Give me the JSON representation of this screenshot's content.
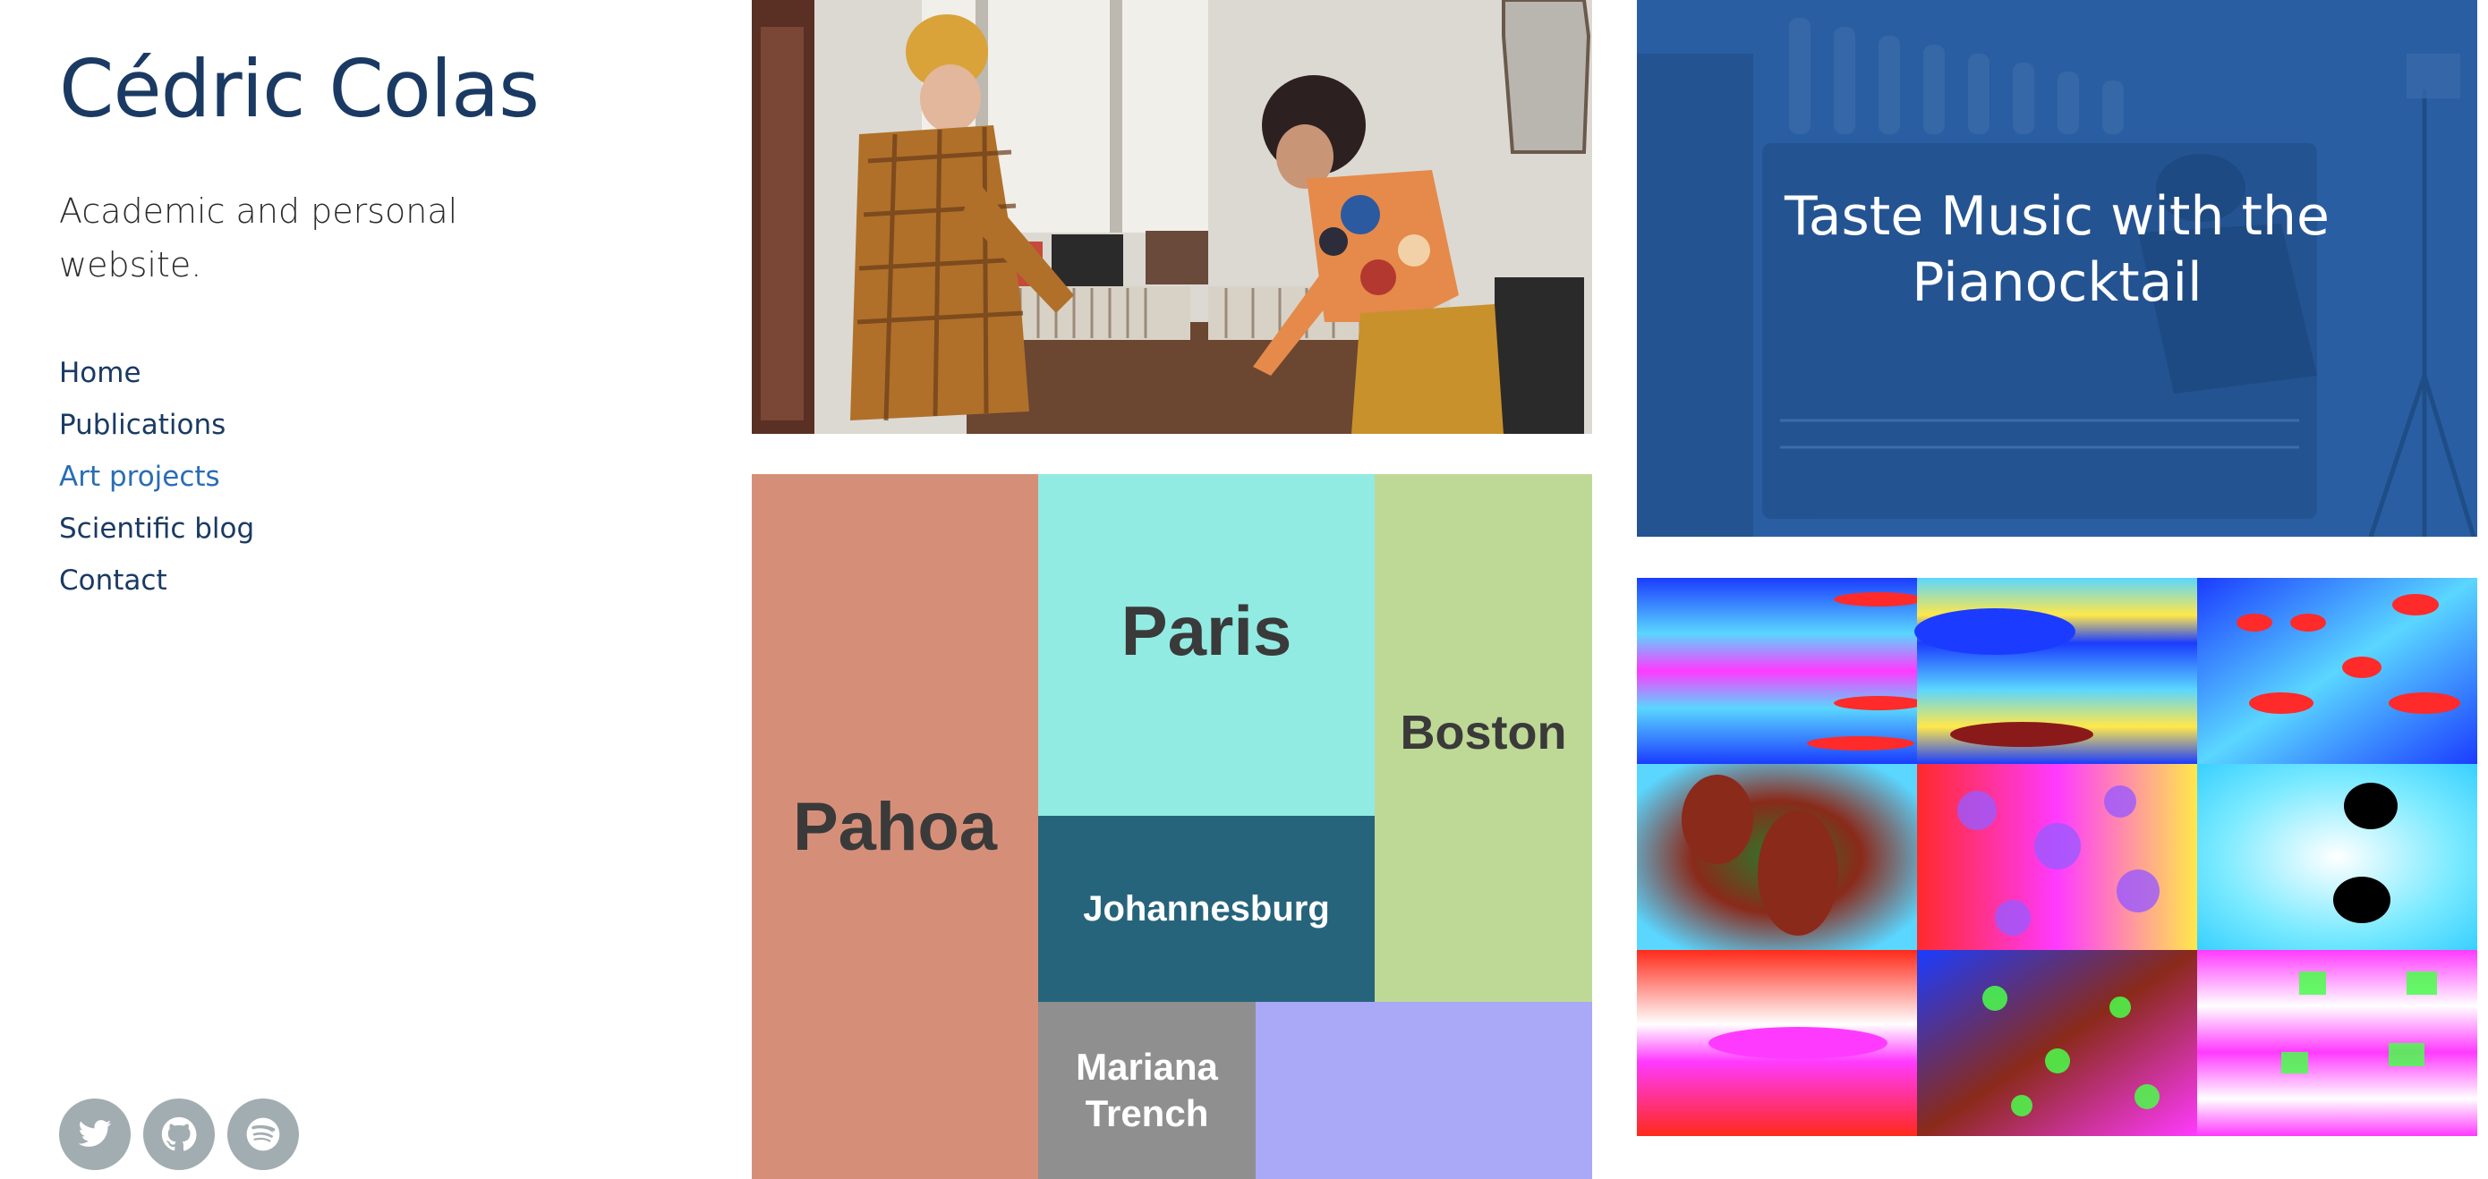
{
  "site": {
    "title": "Cédric Colas",
    "tagline": "Academic and personal website."
  },
  "nav": {
    "items": [
      {
        "label": "Home",
        "active": false
      },
      {
        "label": "Publications",
        "active": false
      },
      {
        "label": "Art projects",
        "active": true
      },
      {
        "label": "Scientific blog",
        "active": false
      },
      {
        "label": "Contact",
        "active": false
      }
    ]
  },
  "social": [
    {
      "icon": "twitter-icon"
    },
    {
      "icon": "github-icon"
    },
    {
      "icon": "spotify-icon"
    }
  ],
  "projects": {
    "pianocktail": {
      "title": "Taste Music with the Pianocktail"
    },
    "treemap": {
      "cells": [
        {
          "label": "Pahoa",
          "color": "#d58f79"
        },
        {
          "label": "Paris",
          "color": "#92ebe2"
        },
        {
          "label": "Boston",
          "color": "#bed995"
        },
        {
          "label": "Johannesburg",
          "color": "#26647c"
        },
        {
          "label": "Mariana Trench",
          "color": "#8f8f8f"
        },
        {
          "label": "",
          "color": "#a9a9f7"
        }
      ]
    }
  },
  "colors": {
    "title": "#1a3a63",
    "nav": "#1a3a63",
    "nav_active": "#2a6db5",
    "social_bg": "#a2adb1",
    "piano_overlay": "#2a5ea3"
  }
}
